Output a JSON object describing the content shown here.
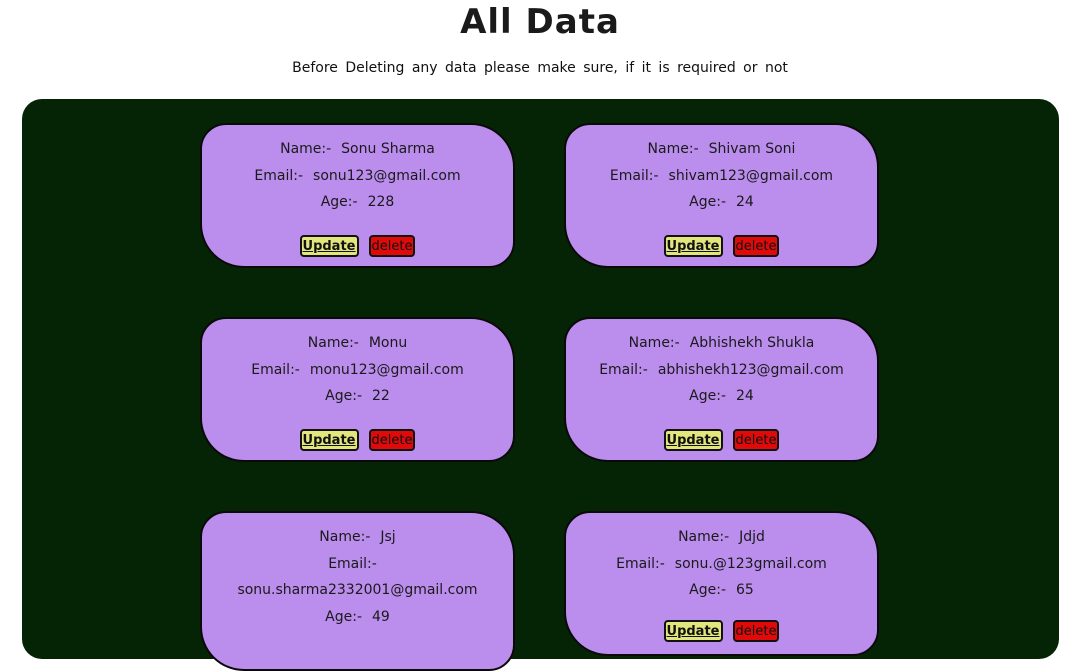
{
  "header": {
    "title": "All Data",
    "subtitle": "Before Deleting any data please make sure, if it is required or not"
  },
  "labels": {
    "name": "Name:-",
    "email": "Email:-",
    "age": "Age:-",
    "update": "Update",
    "delete": "delete"
  },
  "records": [
    {
      "name": "Sonu Sharma",
      "email": "sonu123@gmail.com",
      "age": "228"
    },
    {
      "name": "Shivam Soni",
      "email": "shivam123@gmail.com",
      "age": "24"
    },
    {
      "name": "Monu",
      "email": "monu123@gmail.com",
      "age": "22"
    },
    {
      "name": "Abhishekh Shukla",
      "email": "abhishekh123@gmail.com",
      "age": "24"
    },
    {
      "name": "Jsj",
      "email": "sonu.sharma2332001@gmail.com",
      "age": "49"
    },
    {
      "name": "Jdjd",
      "email": "sonu.@123gmail.com",
      "age": "65"
    }
  ],
  "colors": {
    "panel": "#052405",
    "card": "#bb8ded",
    "update_button": "#e3e57d",
    "delete_button": "#e00a0a"
  }
}
